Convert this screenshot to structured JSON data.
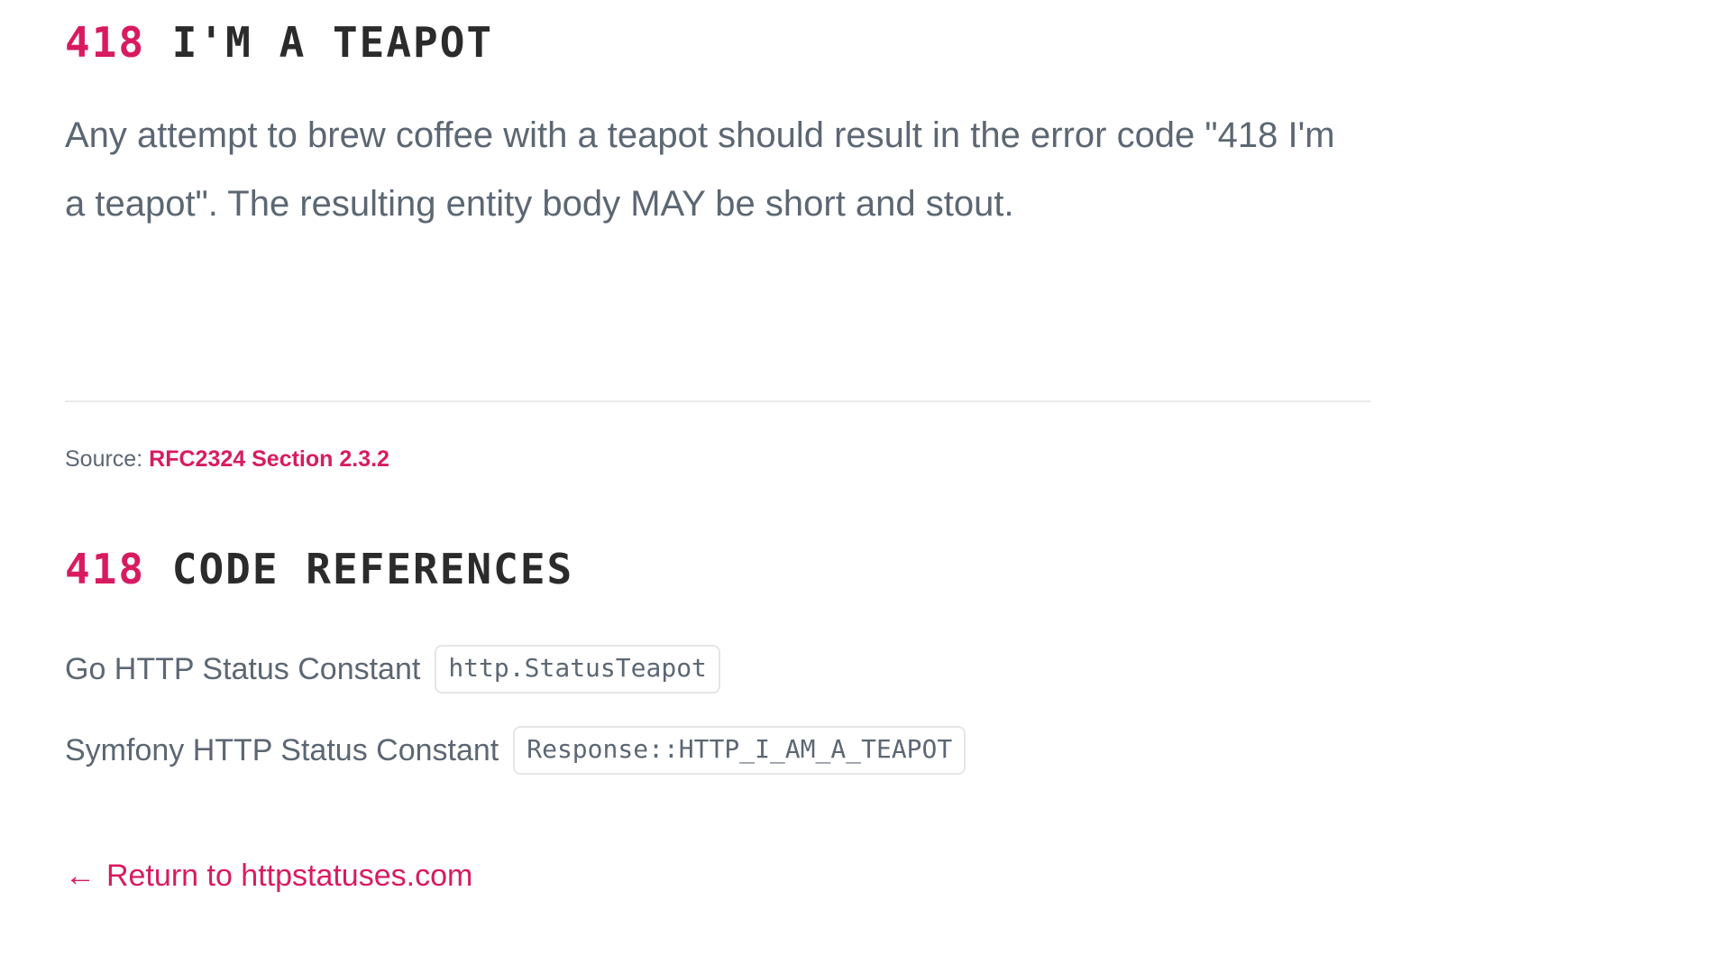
{
  "status": {
    "code": "418",
    "title": "I'M A TEAPOT",
    "description": "Any attempt to brew coffee with a teapot should result in the error code \"418 I'm a teapot\". The resulting entity body MAY be short and stout."
  },
  "source": {
    "label": "Source:",
    "link_text": "RFC2324 Section 2.3.2"
  },
  "references": {
    "heading_code": "418",
    "heading_title": "CODE REFERENCES",
    "rows": [
      {
        "label": "Go HTTP Status Constant",
        "code": "http.StatusTeapot"
      },
      {
        "label": "Symfony HTTP Status Constant",
        "code": "Response::HTTP_I_AM_A_TEAPOT"
      }
    ]
  },
  "footer": {
    "arrow": "←",
    "return_text": "Return to httpstatuses.com"
  },
  "colors": {
    "accent": "#d81b60",
    "heading_dark": "#2b2b2b",
    "body_text": "#5c6773",
    "divider": "#e9eaec",
    "code_border": "#e4e6e8",
    "background": "#ffffff"
  }
}
